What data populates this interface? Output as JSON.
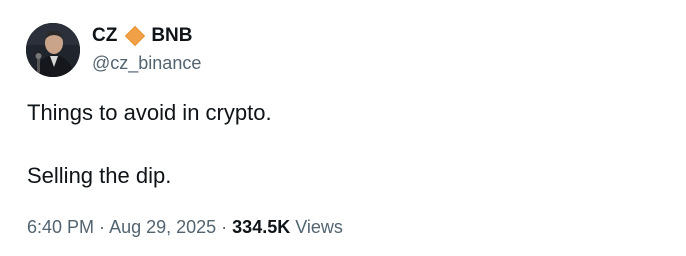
{
  "author": {
    "display_name_first": "CZ",
    "display_name_second": "BNB",
    "handle": "@cz_binance",
    "avatar_icon": "profile-photo",
    "badge_icon": "orange-diamond-icon",
    "badge_color": "#f0a046"
  },
  "tweet": {
    "line_1": "Things to avoid in crypto.",
    "line_2": "Selling the dip."
  },
  "meta": {
    "time": "6:40 PM",
    "separator_1": " · ",
    "date": "Aug 29, 2025",
    "separator_2": " · ",
    "views_count": "334.5K",
    "views_label": " Views"
  },
  "colors": {
    "text_primary": "#0f1419",
    "text_secondary": "#536471",
    "background": "#ffffff"
  }
}
